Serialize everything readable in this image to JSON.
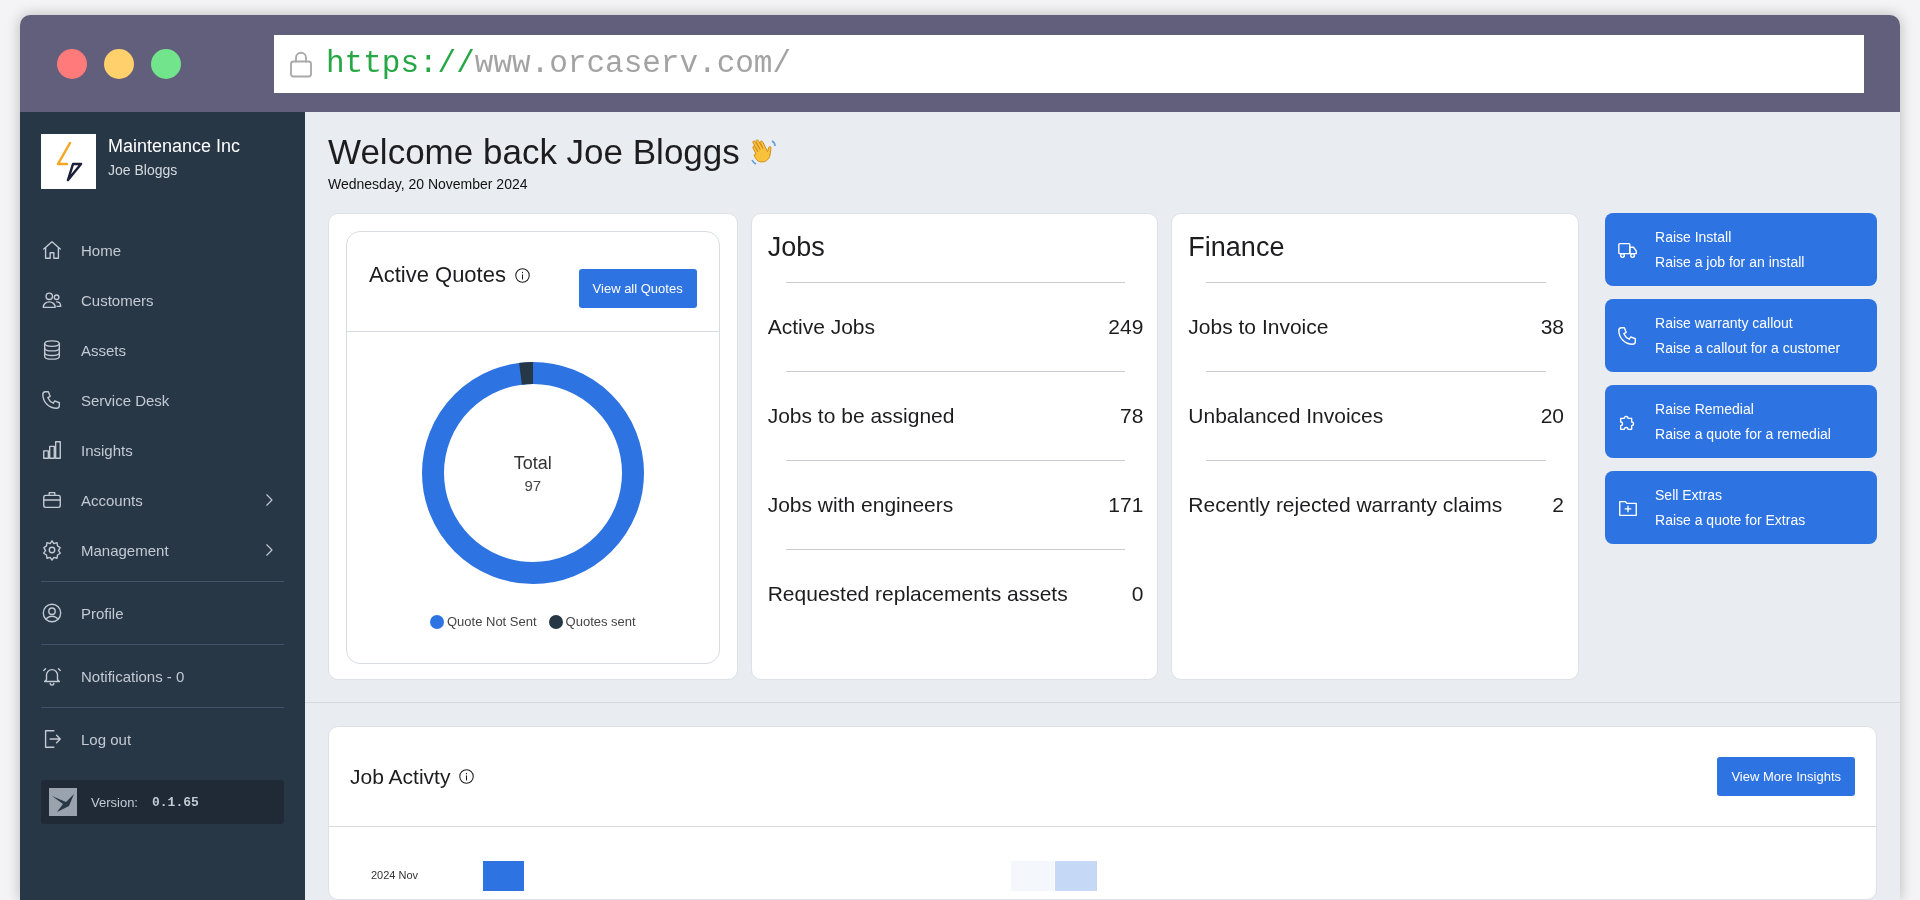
{
  "browser": {
    "url_scheme": "https://",
    "url_rest": "www.orcaserv.com/"
  },
  "sidebar": {
    "company": "Maintenance Inc",
    "user": "Joe Bloggs",
    "groups": [
      [
        {
          "label": "Home",
          "has_submenu": false
        },
        {
          "label": "Customers",
          "has_submenu": false
        },
        {
          "label": "Assets",
          "has_submenu": false
        },
        {
          "label": "Service Desk",
          "has_submenu": false
        },
        {
          "label": "Insights",
          "has_submenu": false
        },
        {
          "label": "Accounts",
          "has_submenu": true
        },
        {
          "label": "Management",
          "has_submenu": true
        }
      ],
      [
        {
          "label": "Profile",
          "has_submenu": false
        }
      ],
      [
        {
          "label": "Notifications - 0",
          "has_submenu": false
        }
      ],
      [
        {
          "label": "Log out",
          "has_submenu": false
        }
      ]
    ],
    "version_label": "Version:",
    "version": "0.1.65"
  },
  "header": {
    "welcome": "Welcome back Joe Bloggs",
    "date": "Wednesday, 20 November 2024"
  },
  "quotes": {
    "title": "Active Quotes",
    "button": "View all Quotes",
    "center_label": "Total",
    "center_value": "97",
    "legend": [
      {
        "label": "Quote Not Sent",
        "color": "#2e73e2"
      },
      {
        "label": "Quotes sent",
        "color": "#263746"
      }
    ]
  },
  "jobs": {
    "title": "Jobs",
    "rows": [
      {
        "label": "Active Jobs",
        "value": "249"
      },
      {
        "label": "Jobs to be assigned",
        "value": "78"
      },
      {
        "label": "Jobs with engineers",
        "value": "171"
      },
      {
        "label": "Requested replacements assets",
        "value": "0"
      }
    ]
  },
  "finance": {
    "title": "Finance",
    "rows": [
      {
        "label": "Jobs to Invoice",
        "value": "38"
      },
      {
        "label": "Unbalanced Invoices",
        "value": "20"
      },
      {
        "label": "Recently rejected warranty claims",
        "value": "2"
      }
    ]
  },
  "actions": [
    {
      "title": "Raise Install",
      "subtitle": "Raise a job for an install"
    },
    {
      "title": "Raise warranty callout",
      "subtitle": "Raise a callout for a customer"
    },
    {
      "title": "Raise Remedial",
      "subtitle": "Raise a quote for a remedial"
    },
    {
      "title": "Sell Extras",
      "subtitle": "Raise a quote for Extras"
    }
  ],
  "activity": {
    "title": "Job Activty",
    "button": "View More Insights",
    "row_label": "2024 Nov"
  }
}
